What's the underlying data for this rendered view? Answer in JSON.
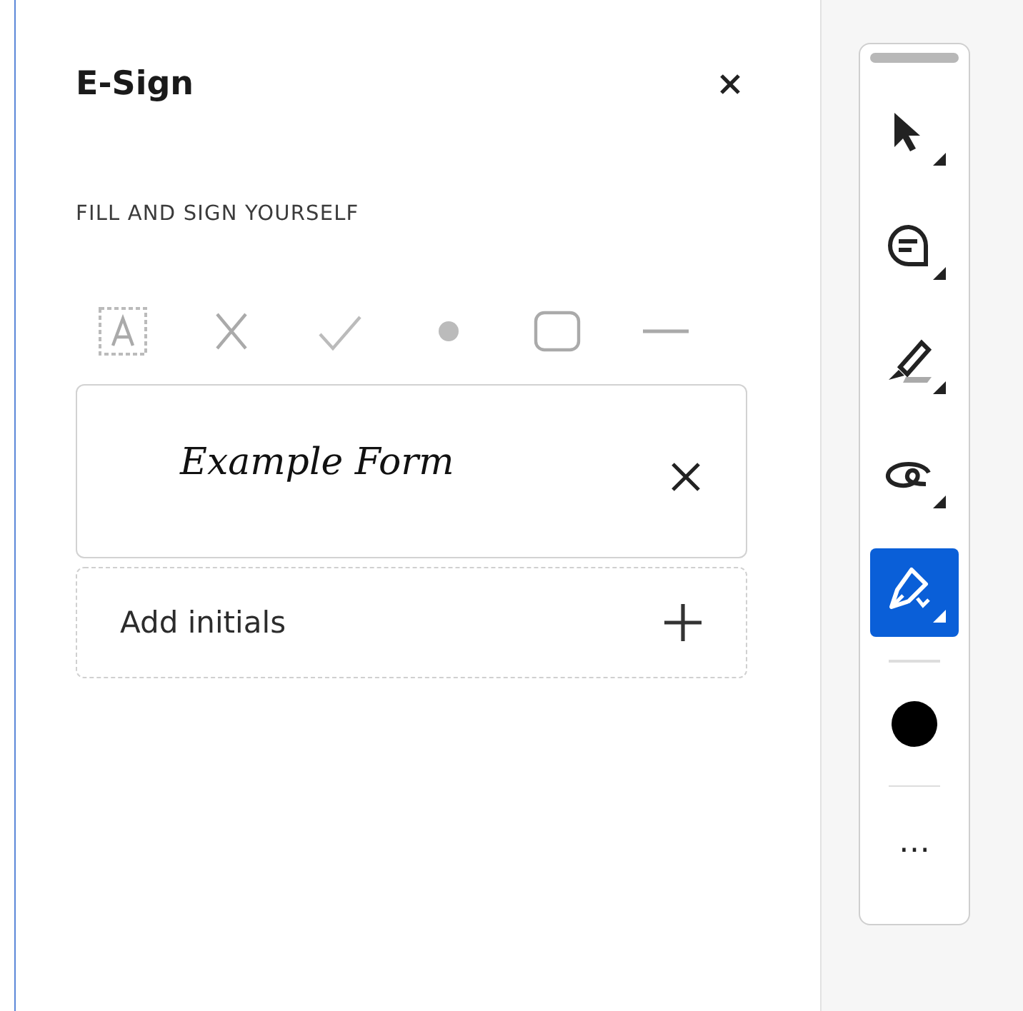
{
  "panel": {
    "title": "E-Sign",
    "section_heading": "FILL AND SIGN YOURSELF",
    "fill_tools": [
      {
        "kind": "text"
      },
      {
        "kind": "cross"
      },
      {
        "kind": "check"
      },
      {
        "kind": "dot"
      },
      {
        "kind": "rect"
      },
      {
        "kind": "line"
      }
    ],
    "signature": {
      "text": "Example Form"
    },
    "initials": {
      "label": "Add initials"
    }
  },
  "toolbar": {
    "tools": [
      {
        "kind": "select",
        "selected": false
      },
      {
        "kind": "comment",
        "selected": false
      },
      {
        "kind": "highlight",
        "selected": false
      },
      {
        "kind": "draw",
        "selected": false
      },
      {
        "kind": "sign",
        "selected": true
      }
    ],
    "more": "⋯"
  }
}
